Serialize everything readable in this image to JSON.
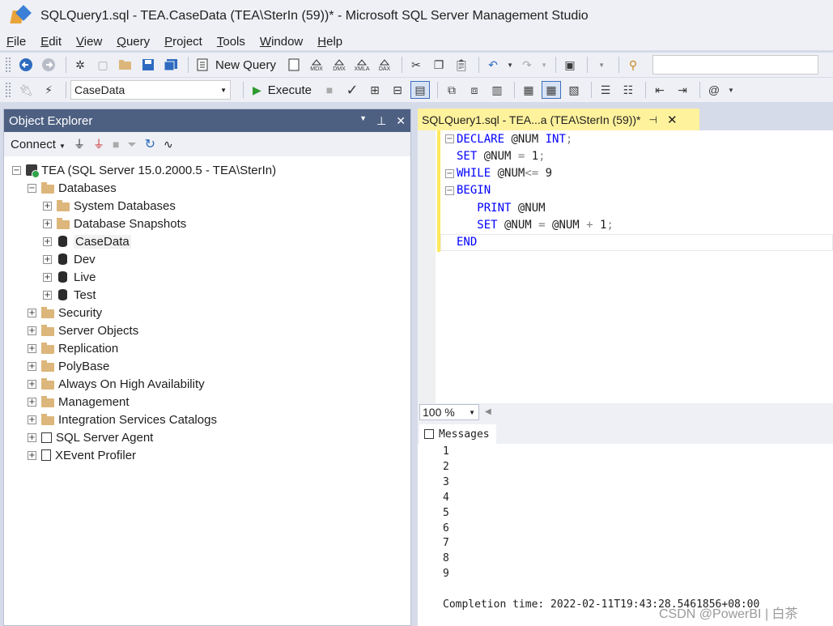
{
  "window": {
    "title": "SQLQuery1.sql - TEA.CaseData (TEA\\SterIn (59))* - Microsoft SQL Server Management Studio"
  },
  "menu": {
    "items": [
      {
        "label": "File"
      },
      {
        "label": "Edit"
      },
      {
        "label": "View"
      },
      {
        "label": "Query"
      },
      {
        "label": "Project"
      },
      {
        "label": "Tools"
      },
      {
        "label": "Window"
      },
      {
        "label": "Help"
      }
    ]
  },
  "toolbar": {
    "new_query_label": "New Query",
    "execute_label": "Execute",
    "database_selected": "CaseData",
    "icons": [
      "back-icon",
      "forward-icon",
      "new-project-icon",
      "add-item-icon",
      "open-file-icon",
      "save-icon",
      "save-all-icon",
      "new-query-icon",
      "mdx-query-icon",
      "dmx-query-icon",
      "xmla-query-icon",
      "dax-query-icon",
      "cut-icon",
      "copy-icon",
      "paste-icon",
      "undo-icon",
      "redo-icon",
      "activity-monitor-icon",
      "find-icon"
    ],
    "mdx": "MDX",
    "dmx": "DMX",
    "xmla": "XMLA",
    "dax": "DAX"
  },
  "object_explorer": {
    "title": "Object Explorer",
    "connect_label": "Connect",
    "tree": [
      {
        "label": "TEA (SQL Server 15.0.2000.5 - TEA\\SterIn)",
        "level": 0,
        "expander": "−",
        "icon": "server-icon"
      },
      {
        "label": "Databases",
        "level": 1,
        "expander": "−",
        "icon": "folder-icon"
      },
      {
        "label": "System Databases",
        "level": 2,
        "expander": "+",
        "icon": "folder-icon"
      },
      {
        "label": "Database Snapshots",
        "level": 2,
        "expander": "+",
        "icon": "folder-icon"
      },
      {
        "label": "CaseData",
        "level": 2,
        "expander": "+",
        "icon": "database-icon",
        "selected": true
      },
      {
        "label": "Dev",
        "level": 2,
        "expander": "+",
        "icon": "database-icon"
      },
      {
        "label": "Live",
        "level": 2,
        "expander": "+",
        "icon": "database-icon"
      },
      {
        "label": "Test",
        "level": 2,
        "expander": "+",
        "icon": "database-icon"
      },
      {
        "label": "Security",
        "level": 1,
        "expander": "+",
        "icon": "folder-icon"
      },
      {
        "label": "Server Objects",
        "level": 1,
        "expander": "+",
        "icon": "folder-icon"
      },
      {
        "label": "Replication",
        "level": 1,
        "expander": "+",
        "icon": "folder-icon"
      },
      {
        "label": "PolyBase",
        "level": 1,
        "expander": "+",
        "icon": "folder-icon"
      },
      {
        "label": "Always On High Availability",
        "level": 1,
        "expander": "+",
        "icon": "folder-icon"
      },
      {
        "label": "Management",
        "level": 1,
        "expander": "+",
        "icon": "folder-icon"
      },
      {
        "label": "Integration Services Catalogs",
        "level": 1,
        "expander": "+",
        "icon": "folder-icon"
      },
      {
        "label": "SQL Server Agent",
        "level": 1,
        "expander": "+",
        "icon": "agent-icon"
      },
      {
        "label": "XEvent Profiler",
        "level": 1,
        "expander": "+",
        "icon": "xevent-icon"
      }
    ]
  },
  "editor": {
    "tab_label": "SQLQuery1.sql - TEA...a (TEA\\SterIn (59))*",
    "lines": [
      [
        {
          "t": "DECLARE",
          "c": "kw"
        },
        {
          "t": " @NUM ",
          "c": "id"
        },
        {
          "t": "INT",
          "c": "kw"
        },
        {
          "t": ";",
          "c": "op"
        }
      ],
      [
        {
          "t": "SET",
          "c": "kw"
        },
        {
          "t": " @NUM ",
          "c": "id"
        },
        {
          "t": "=",
          "c": "op"
        },
        {
          "t": " 1",
          "c": "id"
        },
        {
          "t": ";",
          "c": "op"
        }
      ],
      [
        {
          "t": "WHILE",
          "c": "kw"
        },
        {
          "t": " @NUM",
          "c": "id"
        },
        {
          "t": "<=",
          "c": "op"
        },
        {
          "t": " 9",
          "c": "id"
        }
      ],
      [
        {
          "t": "BEGIN",
          "c": "kw"
        }
      ],
      [
        {
          "t": "   PRINT",
          "c": "kw"
        },
        {
          "t": " @NUM",
          "c": "id"
        }
      ],
      [
        {
          "t": "   SET",
          "c": "kw"
        },
        {
          "t": " @NUM ",
          "c": "id"
        },
        {
          "t": "=",
          "c": "op"
        },
        {
          "t": " @NUM ",
          "c": "id"
        },
        {
          "t": "+",
          "c": "op"
        },
        {
          "t": " 1",
          "c": "id"
        },
        {
          "t": ";",
          "c": "op"
        }
      ],
      [
        {
          "t": "END",
          "c": "kw"
        }
      ]
    ],
    "fold_markers": [
      "−",
      "",
      "−",
      "−",
      "",
      "",
      ""
    ],
    "zoom": "100 %"
  },
  "results": {
    "tab_label": "Messages",
    "messages": [
      "1",
      "2",
      "3",
      "4",
      "5",
      "6",
      "7",
      "8",
      "9",
      "",
      "Completion time: 2022-02-11T19:43:28.5461856+08:00"
    ]
  },
  "watermark": "CSDN @PowerBI | 白茶",
  "colors": {
    "keyword": "#0000ff",
    "operator": "#808080",
    "tab_active": "#fff29d",
    "panel_header": "#4d6082"
  }
}
